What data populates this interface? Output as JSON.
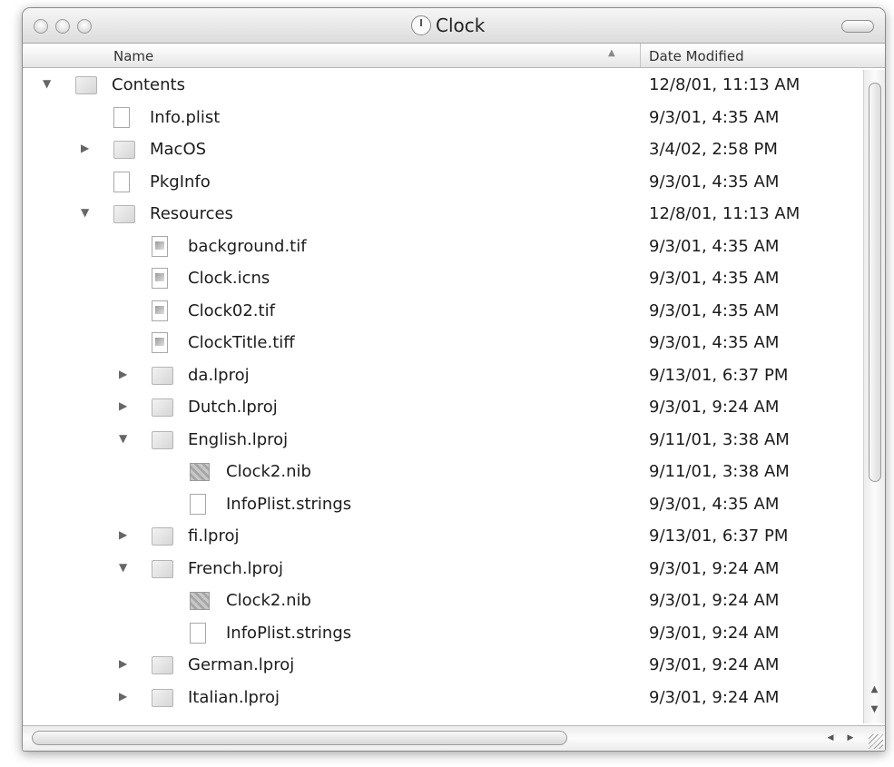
{
  "window": {
    "title": "Clock"
  },
  "columns": {
    "name": "Name",
    "date": "Date Modified"
  },
  "rows": [
    {
      "name": "Contents",
      "date": "12/8/01, 11:13 AM",
      "level": 0,
      "icon": "folder-icon",
      "expand": "expanded"
    },
    {
      "name": "Info.plist",
      "date": "9/3/01, 4:35 AM",
      "level": 1,
      "icon": "file-icon",
      "expand": "none"
    },
    {
      "name": "MacOS",
      "date": "3/4/02, 2:58 PM",
      "level": 1,
      "icon": "folder-icon",
      "expand": "collapsed"
    },
    {
      "name": "PkgInfo",
      "date": "9/3/01, 4:35 AM",
      "level": 1,
      "icon": "file-icon",
      "expand": "none"
    },
    {
      "name": "Resources",
      "date": "12/8/01, 11:13 AM",
      "level": 1,
      "icon": "folder-icon",
      "expand": "expanded"
    },
    {
      "name": "background.tif",
      "date": "9/3/01, 4:35 AM",
      "level": 2,
      "icon": "image-file-icon",
      "expand": "none"
    },
    {
      "name": "Clock.icns",
      "date": "9/3/01, 4:35 AM",
      "level": 2,
      "icon": "image-file-icon",
      "expand": "none"
    },
    {
      "name": "Clock02.tif",
      "date": "9/3/01, 4:35 AM",
      "level": 2,
      "icon": "image-file-icon",
      "expand": "none"
    },
    {
      "name": "ClockTitle.tiff",
      "date": "9/3/01, 4:35 AM",
      "level": 2,
      "icon": "image-file-icon",
      "expand": "none"
    },
    {
      "name": "da.lproj",
      "date": "9/13/01, 6:37 PM",
      "level": 2,
      "icon": "folder-icon",
      "expand": "collapsed"
    },
    {
      "name": "Dutch.lproj",
      "date": "9/3/01, 9:24 AM",
      "level": 2,
      "icon": "folder-icon",
      "expand": "collapsed"
    },
    {
      "name": "English.lproj",
      "date": "9/11/01, 3:38 AM",
      "level": 2,
      "icon": "folder-icon",
      "expand": "expanded"
    },
    {
      "name": "Clock2.nib",
      "date": "9/11/01, 3:38 AM",
      "level": 3,
      "icon": "nib-file-icon",
      "expand": "none"
    },
    {
      "name": "InfoPlist.strings",
      "date": "9/3/01, 4:35 AM",
      "level": 3,
      "icon": "file-icon",
      "expand": "none"
    },
    {
      "name": "fi.lproj",
      "date": "9/13/01, 6:37 PM",
      "level": 2,
      "icon": "folder-icon",
      "expand": "collapsed"
    },
    {
      "name": "French.lproj",
      "date": "9/3/01, 9:24 AM",
      "level": 2,
      "icon": "folder-icon",
      "expand": "expanded"
    },
    {
      "name": "Clock2.nib",
      "date": "9/3/01, 9:24 AM",
      "level": 3,
      "icon": "nib-file-icon",
      "expand": "none"
    },
    {
      "name": "InfoPlist.strings",
      "date": "9/3/01, 9:24 AM",
      "level": 3,
      "icon": "file-icon",
      "expand": "none"
    },
    {
      "name": "German.lproj",
      "date": "9/3/01, 9:24 AM",
      "level": 2,
      "icon": "folder-icon",
      "expand": "collapsed"
    },
    {
      "name": "Italian.lproj",
      "date": "9/3/01, 9:24 AM",
      "level": 2,
      "icon": "folder-icon",
      "expand": "collapsed"
    }
  ],
  "glyphs": {
    "expanded": "▼",
    "collapsed": "▶",
    "sort": "▲",
    "up": "▲",
    "down": "▼",
    "left": "◀",
    "right": "▶"
  }
}
